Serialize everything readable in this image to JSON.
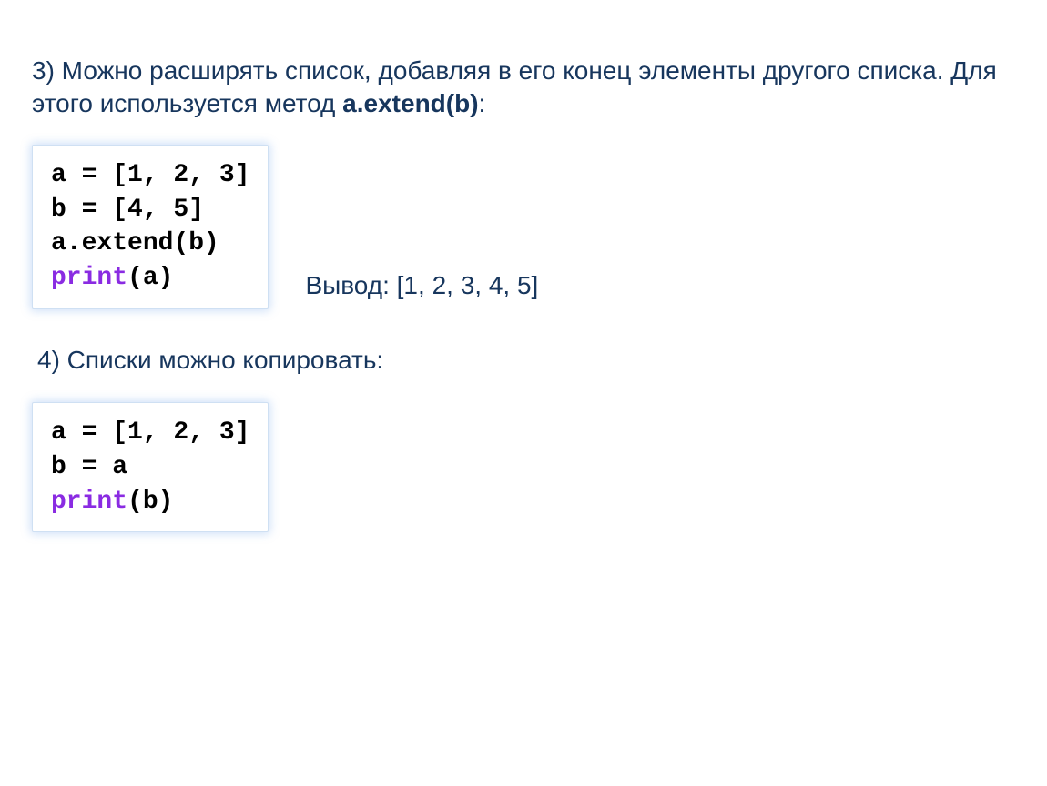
{
  "section3": {
    "text_before_bold": "3) Можно расширять список, добавляя в его конец элементы другого списка. Для этого используется метод ",
    "bold": "a.extend(b)",
    "text_after_bold": ":"
  },
  "code1": {
    "line1": "a = [1, 2, 3]",
    "line2": "b = [4, 5]",
    "line3": "a.extend(b)",
    "print_kw": "print",
    "print_arg": "(a)"
  },
  "output1": "Вывод: [1, 2, 3, 4, 5]",
  "section4": "4) Списки можно копировать:",
  "code2": {
    "line1": "a = [1, 2, 3]",
    "line2": "b = a",
    "print_kw": "print",
    "print_arg": "(b)"
  }
}
